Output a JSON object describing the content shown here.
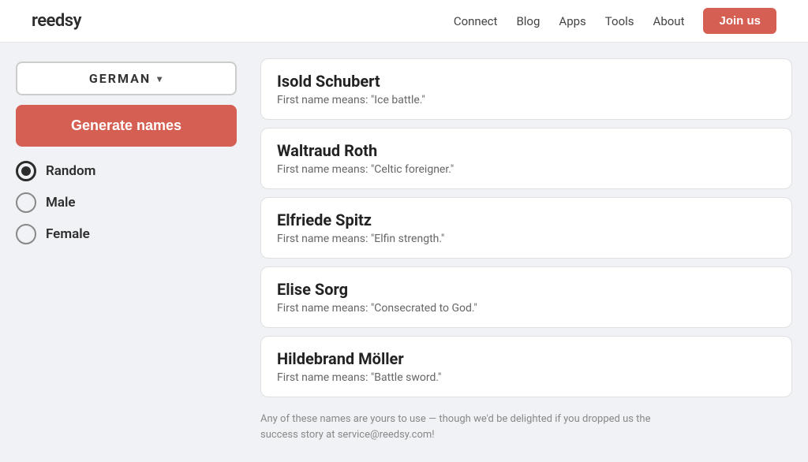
{
  "header": {
    "logo": "reedsy",
    "nav": [
      "Connect",
      "Blog",
      "Apps",
      "Tools",
      "About"
    ],
    "join_label": "Join us"
  },
  "sidebar": {
    "dropdown_label": "GERMAN",
    "generate_label": "Generate names",
    "radio_options": [
      {
        "id": "random",
        "label": "Random",
        "selected": true
      },
      {
        "id": "male",
        "label": "Male",
        "selected": false
      },
      {
        "id": "female",
        "label": "Female",
        "selected": false
      }
    ]
  },
  "names": [
    {
      "full_name": "Isold Schubert",
      "meaning": "First name means: \"Ice battle.\""
    },
    {
      "full_name": "Waltraud Roth",
      "meaning": "First name means: \"Celtic foreigner.\""
    },
    {
      "full_name": "Elfriede Spitz",
      "meaning": "First name means: \"Elfin strength.\""
    },
    {
      "full_name": "Elise Sorg",
      "meaning": "First name means: \"Consecrated to God.\""
    },
    {
      "full_name": "Hildebrand Möller",
      "meaning": "First name means: \"Battle sword.\""
    }
  ],
  "footer_note": "Any of these names are yours to use — though we'd be delighted if you dropped us the success story at service@reedsy.com!"
}
